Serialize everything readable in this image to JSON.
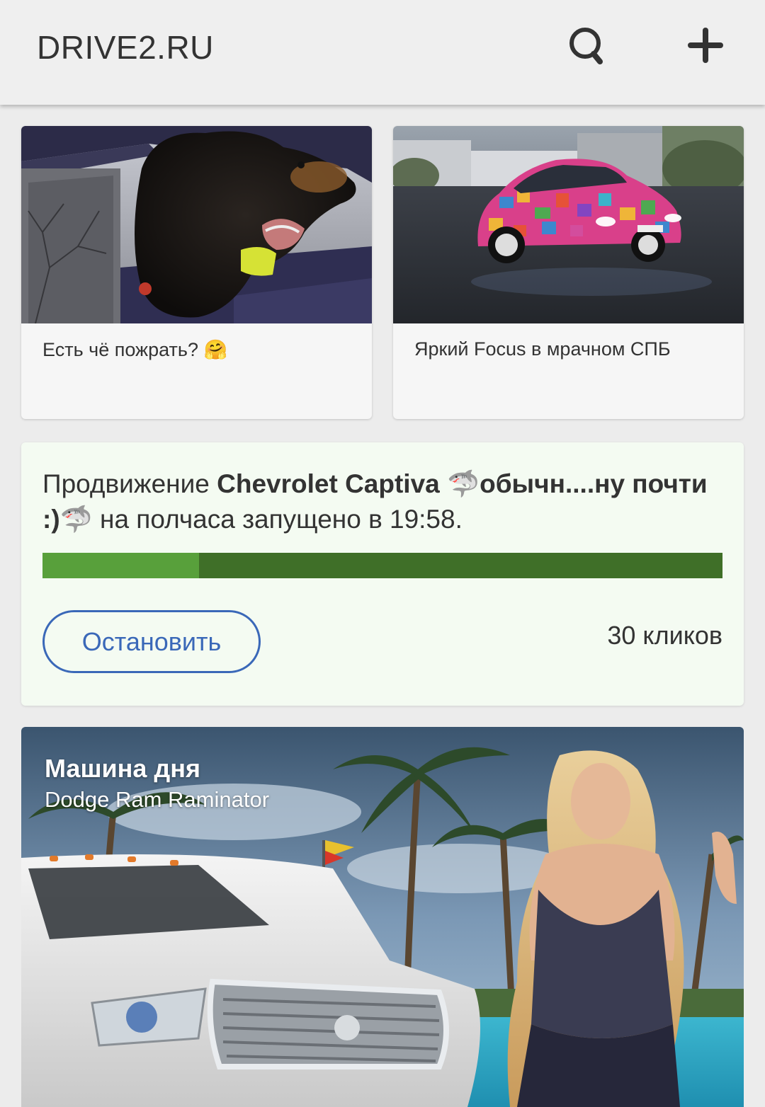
{
  "appbar": {
    "title": "DRIVE2.RU",
    "search_icon": "search-icon",
    "add_icon": "plus-icon"
  },
  "feed": [
    {
      "caption": "Есть чё пожрать? 🤗",
      "image": "dog-in-car-window-photo"
    },
    {
      "caption": "Яркий Focus в мрачном СПБ",
      "image": "colorful-ford-focus-photo"
    }
  ],
  "promo": {
    "prefix": "Продвижение ",
    "car_name": "Chevrolet Captiva ",
    "shark1": "🦈",
    "nickname": "обычн....ну почти :)",
    "shark2": "🦈",
    "suffix": " на полчаса запущено в 19:58.",
    "progress": 0.23,
    "stop_label": "Остановить",
    "clicks": "30 кликов",
    "colors": {
      "bar_bg": "#3f6f28",
      "bar_fill": "#58a03b",
      "button": "#3a68b8"
    }
  },
  "car_of_day": {
    "heading": "Машина дня",
    "car": "Dodge Ram Raminator"
  }
}
